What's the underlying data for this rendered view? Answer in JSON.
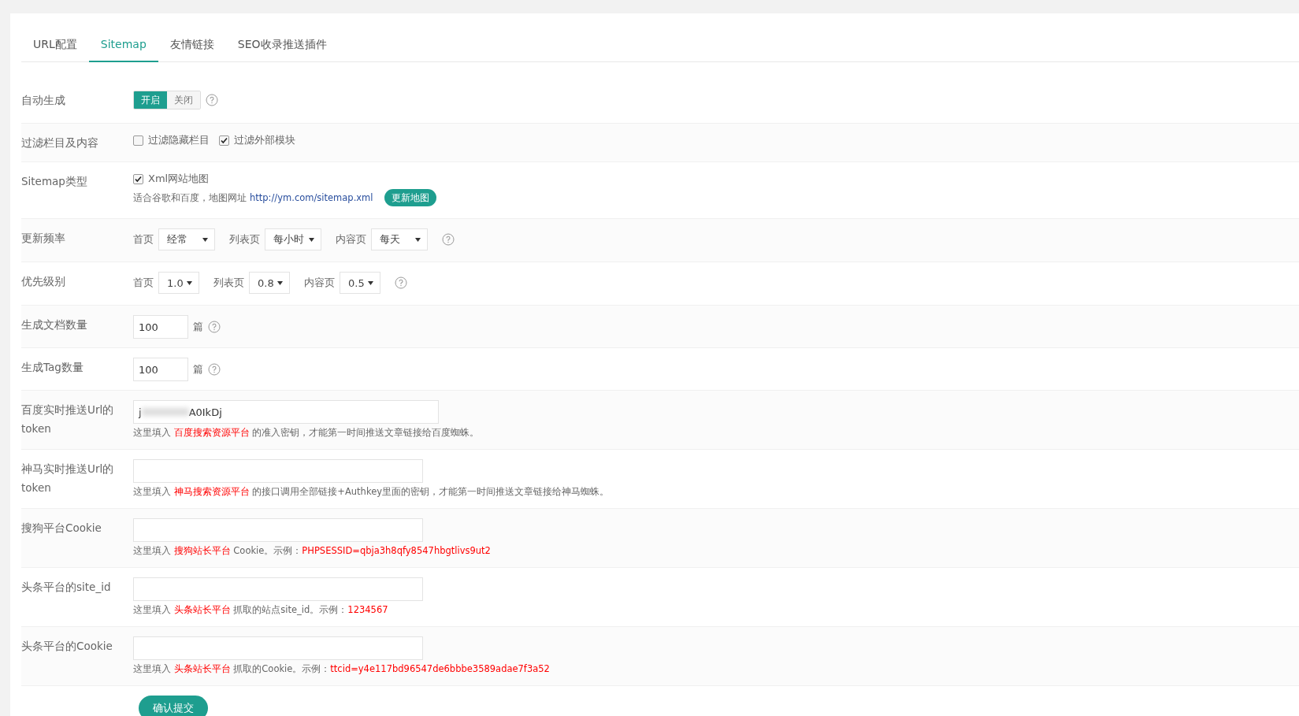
{
  "tabs": [
    {
      "label": "URL配置",
      "selected": false
    },
    {
      "label": "Sitemap",
      "selected": true
    },
    {
      "label": "友情链接",
      "selected": false
    },
    {
      "label": "SEO收录推送插件",
      "selected": false
    }
  ],
  "rows": [
    {
      "kind": "toggle",
      "label": "自动生成",
      "options": [
        {
          "label": "开启",
          "selected": true
        },
        {
          "label": "关闭",
          "selected": false
        }
      ],
      "help": true
    },
    {
      "kind": "checkboxes",
      "label": "过滤栏目及内容",
      "options": [
        {
          "label": "过滤隐藏栏目",
          "checked": false
        },
        {
          "label": "过滤外部模块",
          "checked": true
        }
      ]
    },
    {
      "kind": "sitemap",
      "label": "Sitemap类型",
      "option": {
        "label": "Xml网站地图",
        "checked": true
      },
      "note": "适合谷歌和百度，地图网址",
      "link": "http://ym.com/sitemap.xml",
      "button": "更新地图"
    },
    {
      "kind": "frequency",
      "label": "更新频率",
      "selects": [
        {
          "label": "首页",
          "value": "经常"
        },
        {
          "label": "列表页",
          "value": "每小时"
        },
        {
          "label": "内容页",
          "value": "每天"
        }
      ],
      "help": true
    },
    {
      "kind": "priority",
      "label": "优先级别",
      "selects": [
        {
          "label": "首页",
          "value": "1.0"
        },
        {
          "label": "列表页",
          "value": "0.8"
        },
        {
          "label": "内容页",
          "value": "0.5"
        }
      ],
      "help": true
    },
    {
      "kind": "number",
      "label": "生成文档数量",
      "value": "100",
      "unit": "篇",
      "help": true
    },
    {
      "kind": "number",
      "label": "生成Tag数量",
      "value": "100",
      "unit": "篇",
      "help": true
    },
    {
      "kind": "text",
      "label": "百度实时推送Url的token",
      "value_start": "j",
      "value_end": "A0IkDj",
      "blurred": true,
      "hint": [
        {
          "kind": "plain",
          "text": "这里填入 "
        },
        {
          "kind": "red",
          "text": "百度搜索资源平台"
        },
        {
          "kind": "plain",
          "text": " 的准入密钥，才能第一时间推送文章链接给百度蜘蛛。"
        }
      ]
    },
    {
      "kind": "text",
      "label": "神马实时推送Url的token",
      "hint": [
        {
          "kind": "plain",
          "text": "这里填入 "
        },
        {
          "kind": "red",
          "text": "神马搜索资源平台"
        },
        {
          "kind": "plain",
          "text": " 的接口调用全部链接+Authkey里面的密钥，才能第一时间推送文章链接给神马蜘蛛。"
        }
      ]
    },
    {
      "kind": "text",
      "label": "搜狗平台Cookie",
      "hint": [
        {
          "kind": "plain",
          "text": "这里填入 "
        },
        {
          "kind": "red",
          "text": "搜狗站长平台"
        },
        {
          "kind": "plain",
          "text": " Cookie。示例："
        },
        {
          "kind": "red",
          "text": "PHPSESSID=qbja3h8qfy8547hbgtlivs9ut2"
        }
      ]
    },
    {
      "kind": "text",
      "label": "头条平台的site_id",
      "hint": [
        {
          "kind": "plain",
          "text": "这里填入 "
        },
        {
          "kind": "red",
          "text": "头条站长平台"
        },
        {
          "kind": "plain",
          "text": " 抓取的站点site_id。示例："
        },
        {
          "kind": "red",
          "text": "1234567"
        }
      ]
    },
    {
      "kind": "text",
      "label": "头条平台的Cookie",
      "hint": [
        {
          "kind": "plain",
          "text": "这里填入 "
        },
        {
          "kind": "red",
          "text": "头条站长平台"
        },
        {
          "kind": "plain",
          "text": " 抓取的Cookie。示例："
        },
        {
          "kind": "red",
          "text": "ttcid=y4e117bd96547de6bbbe3589adae7f3a52"
        }
      ]
    }
  ],
  "submit": "确认提交"
}
